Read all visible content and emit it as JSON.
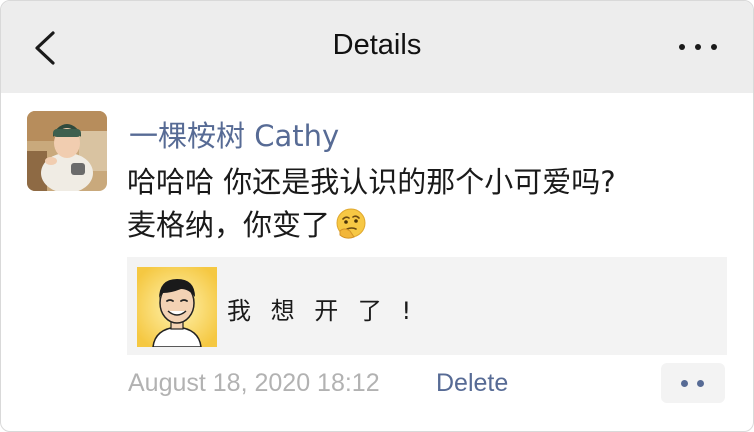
{
  "navbar": {
    "back_icon": "chevron-left-icon",
    "title": "Details",
    "more_icon": "more-dots-icon"
  },
  "post": {
    "author": "一棵桉树 Cathy",
    "text_line1": "哈哈哈 你还是我认识的那个小可爱吗?",
    "text_line2": "麦格纳，你变了",
    "emoji": "thinking-face-emoji",
    "link_card": {
      "title": "我 想 开 了 !"
    },
    "timestamp": "August 18, 2020 18:12",
    "delete_label": "Delete",
    "action_icon": "comment-like-dots-icon"
  },
  "colors": {
    "navbar_bg": "#ededed",
    "name_link": "#576b95",
    "timestamp": "#b2b2b2",
    "card_bg": "#f3f3f3"
  }
}
